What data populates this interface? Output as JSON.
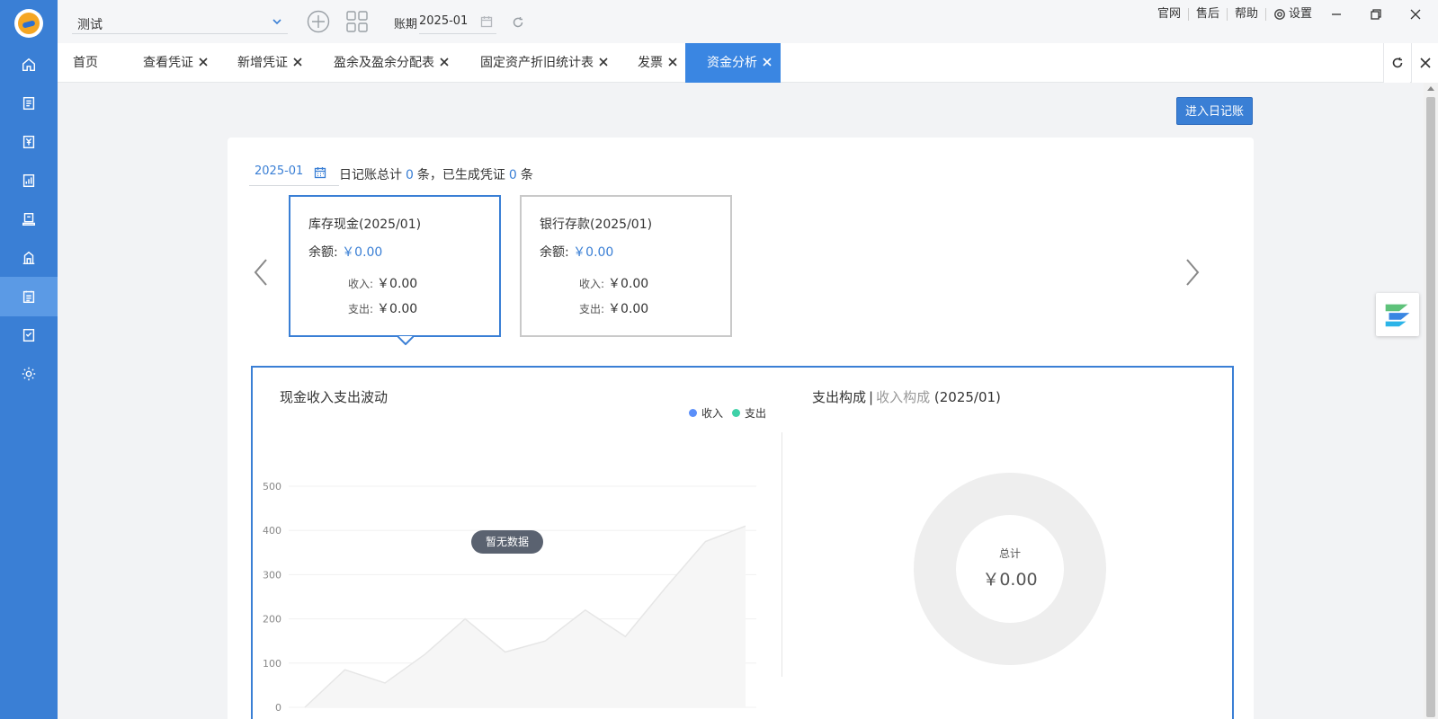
{
  "company": {
    "name": "测试"
  },
  "period": {
    "label": "账期",
    "value": "2025-01"
  },
  "toplinks": {
    "official": "官网",
    "aftersales": "售后",
    "help": "帮助",
    "settings": "设置"
  },
  "tabs": [
    {
      "label": "首页"
    },
    {
      "label": "查看凭证"
    },
    {
      "label": "新增凭证"
    },
    {
      "label": "盈余及盈余分配表"
    },
    {
      "label": "固定资产折旧统计表"
    },
    {
      "label": "发票"
    },
    {
      "label": "资金分析"
    }
  ],
  "content": {
    "journal_button": "进入日记账",
    "date": "2025-01",
    "summary": {
      "prefix": "日记账总计",
      "total": "0",
      "mid": "条，已生成凭证",
      "generated": "0",
      "suffix": "条"
    }
  },
  "accounts": [
    {
      "name": "库存现金(2025/01)",
      "balance_label": "余额:",
      "balance": "￥0.00",
      "income_label": "收入:",
      "income": "￥0.00",
      "expense_label": "支出:",
      "expense": "￥0.00"
    },
    {
      "name": "银行存款(2025/01)",
      "balance_label": "余额:",
      "balance": "￥0.00",
      "income_label": "收入:",
      "income": "￥0.00",
      "expense_label": "支出:",
      "expense": "￥0.00"
    }
  ],
  "line_chart": {
    "title": "现金收入支出波动",
    "nodata": "暂无数据",
    "legend": [
      {
        "name": "收入",
        "color": "#5b8ff9"
      },
      {
        "name": "支出",
        "color": "#3fd1a8"
      }
    ]
  },
  "pie_chart": {
    "title_active": "支出构成",
    "sep": "|",
    "title_inactive": "收入构成",
    "period": "(2025/01)",
    "center_label": "总计",
    "center_value": "￥0.00"
  },
  "chart_data": {
    "type": "area",
    "ylim": [
      0,
      500
    ],
    "yticks": [
      0,
      100,
      200,
      300,
      400,
      500
    ],
    "placeholder_values": [
      0,
      85,
      55,
      120,
      200,
      125,
      150,
      220,
      160,
      270,
      375,
      410
    ]
  },
  "colors": {
    "accent": "#3a7fd5",
    "sidebar": "#3a7fd5",
    "active_tab": "#3a86e2"
  }
}
